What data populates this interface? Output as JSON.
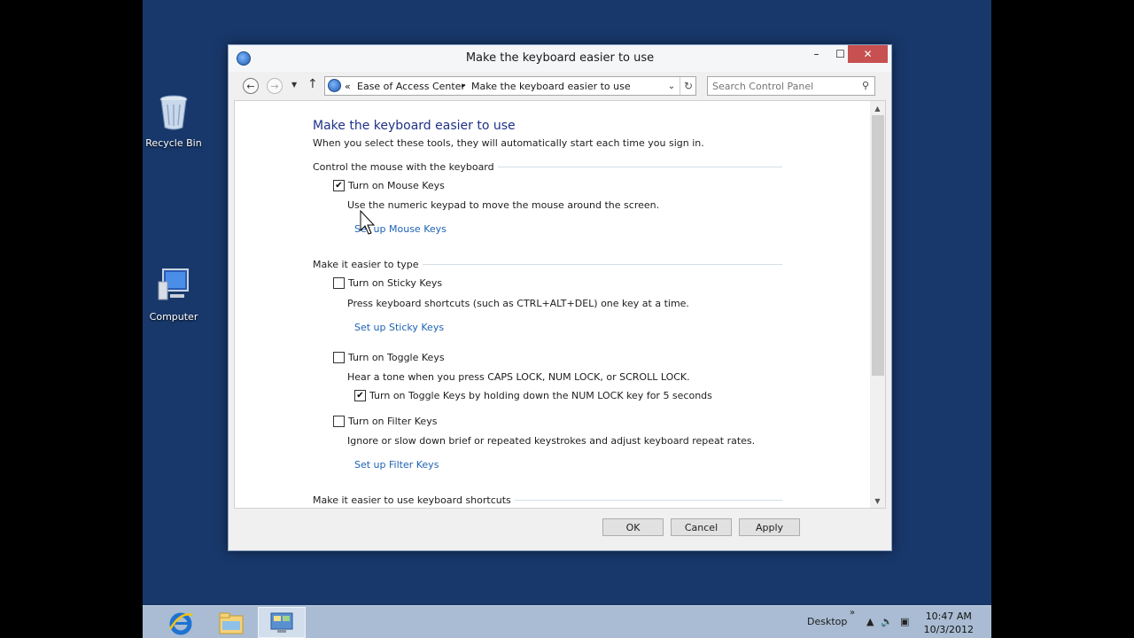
{
  "desktop": {
    "icons": [
      {
        "label": "Recycle Bin"
      },
      {
        "label": "Computer"
      }
    ]
  },
  "window": {
    "title": "Make the keyboard easier to use",
    "controls": {
      "minimize": "–",
      "maximize": "☐",
      "close": "✕"
    },
    "address": {
      "chevron": "«",
      "segments": [
        "Ease of Access Center",
        "Make the keyboard easier to use"
      ],
      "separator": "▸"
    },
    "search": {
      "placeholder": "Search Control Panel"
    }
  },
  "content": {
    "title": "Make the keyboard easier to use",
    "subtitle": "When you select these tools, they will automatically start each time you sign in.",
    "sections": [
      {
        "label": "Control the mouse with the keyboard",
        "options": [
          {
            "label": "Turn on Mouse Keys",
            "checked": true,
            "description": "Use the numeric keypad to move the mouse around the screen.",
            "link": "Set up Mouse Keys"
          }
        ]
      },
      {
        "label": "Make it easier to type",
        "options": [
          {
            "label": "Turn on Sticky Keys",
            "checked": false,
            "description": "Press keyboard shortcuts (such as CTRL+ALT+DEL) one key at a time.",
            "link": "Set up Sticky Keys"
          },
          {
            "label": "Turn on Toggle Keys",
            "checked": false,
            "description": "Hear a tone when you press CAPS LOCK, NUM LOCK, or SCROLL LOCK.",
            "suboption": {
              "label": "Turn on Toggle Keys by holding down the NUM LOCK key for 5 seconds",
              "checked": true
            }
          },
          {
            "label": "Turn on Filter Keys",
            "checked": false,
            "description": "Ignore or slow down brief or repeated keystrokes and adjust keyboard repeat rates.",
            "link": "Set up Filter Keys"
          }
        ]
      },
      {
        "label": "Make it easier to use keyboard shortcuts"
      }
    ]
  },
  "buttons": {
    "ok": "OK",
    "cancel": "Cancel",
    "apply": "Apply"
  },
  "taskbar": {
    "desktop_label": "Desktop",
    "overflow": "»",
    "clock_time": "10:47 AM",
    "clock_date": "10/3/2012"
  },
  "icons": [
    "recycle-bin-icon",
    "computer-icon",
    "ease-of-access-icon",
    "internet-explorer-icon",
    "file-explorer-icon",
    "control-panel-icon",
    "search-icon",
    "refresh-icon",
    "speaker-icon",
    "network-icon",
    "mouse-cursor-icon"
  ],
  "colors": {
    "desktop_bg": "#18386b",
    "link": "#1e62b4",
    "title_blue": "#1e3287",
    "close_btn": "#c75050",
    "taskbar": "#a9bcd3"
  }
}
